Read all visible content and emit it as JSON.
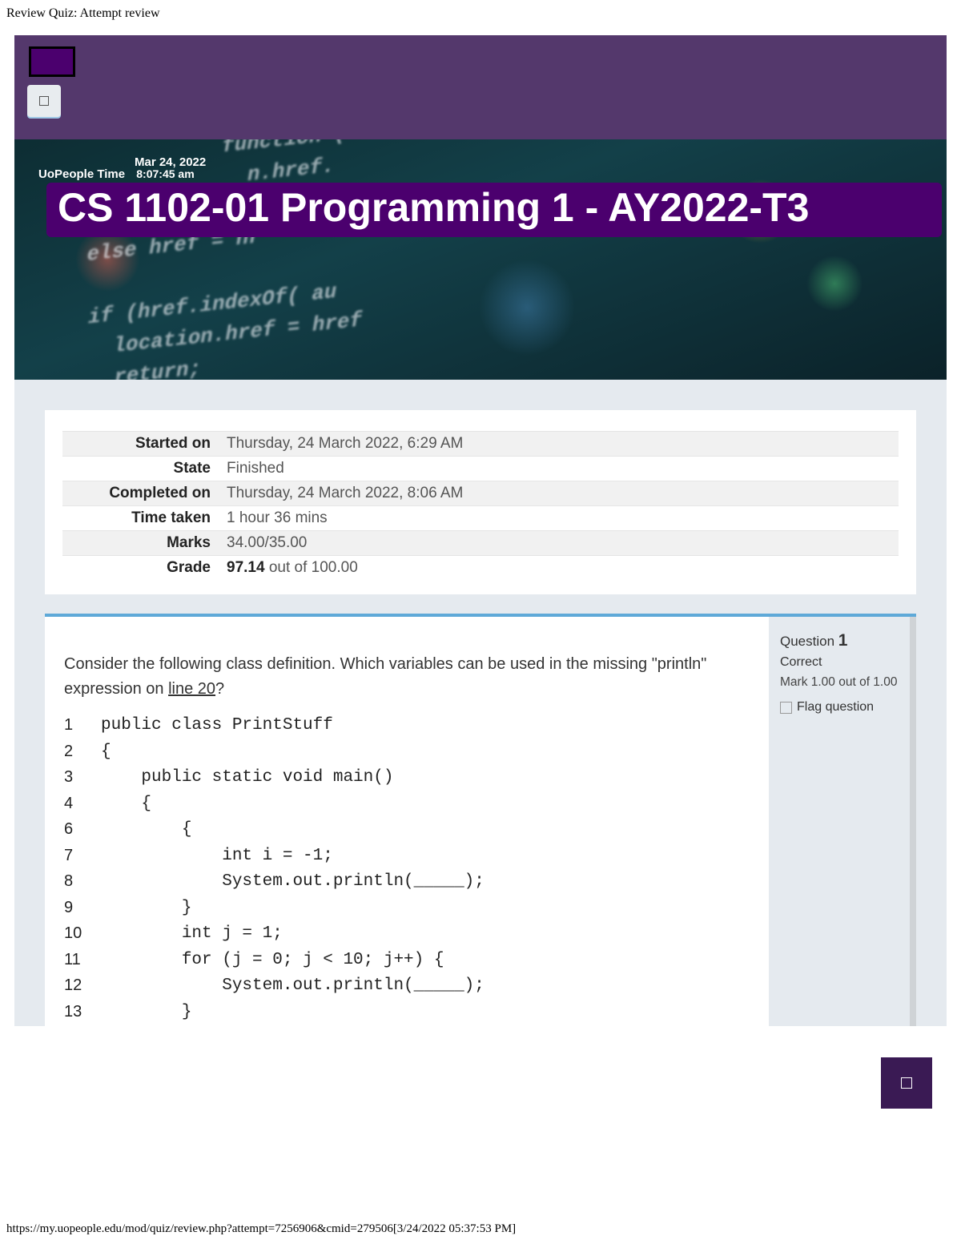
{
  "doc_title": "Review Quiz: Attempt review",
  "header": {
    "uopeople_label": "UoPeople Time",
    "date": "Mar 24, 2022",
    "time": "8:07:45 am"
  },
  "course_title": "CS 1102-01 Programming 1 - AY2022-T3",
  "hero_code": "           function (\n             n.href.\nif (hre\nelse href = hr\n\nif (href.indexOf( au\n  location.href = href\n  return;",
  "summary": [
    {
      "label": "Started on",
      "value": "Thursday, 24 March 2022, 6:29 AM"
    },
    {
      "label": "State",
      "value": "Finished"
    },
    {
      "label": "Completed on",
      "value": "Thursday, 24 March 2022, 8:06 AM"
    },
    {
      "label": "Time taken",
      "value": "1 hour 36 mins"
    },
    {
      "label": "Marks",
      "value": "34.00/35.00"
    },
    {
      "label": "Grade",
      "value_strong": "97.14",
      "value_rest": " out of 100.00"
    }
  ],
  "question": {
    "prompt_a": "Consider the following class definition. Which variables can be used in the missing \"println\" expression on ",
    "prompt_link": "line 20",
    "prompt_b": "?",
    "code": [
      {
        "n": "1",
        "t": "public class PrintStuff"
      },
      {
        "n": "2",
        "t": "{"
      },
      {
        "n": "3",
        "t": "    public static void main()"
      },
      {
        "n": "4",
        "t": "    {"
      },
      {
        "n": "6",
        "t": "        {"
      },
      {
        "n": "7",
        "t": "            int i = -1;"
      },
      {
        "n": "8",
        "t": "            System.out.println(_____);"
      },
      {
        "n": "9",
        "t": "        }"
      },
      {
        "n": "10",
        "t": "        int j = 1;"
      },
      {
        "n": "11",
        "t": "        for (j = 0; j < 10; j++) {"
      },
      {
        "n": "12",
        "t": "            System.out.println(_____);"
      },
      {
        "n": "13",
        "t": "        }"
      }
    ],
    "side": {
      "label": "Question",
      "number": "1",
      "state": "Correct",
      "mark": "Mark 1.00 out of 1.00",
      "flag": "Flag question"
    }
  },
  "footer_url": "https://my.uopeople.edu/mod/quiz/review.php?attempt=7256906&cmid=279506[3/24/2022 05:37:53 PM]"
}
